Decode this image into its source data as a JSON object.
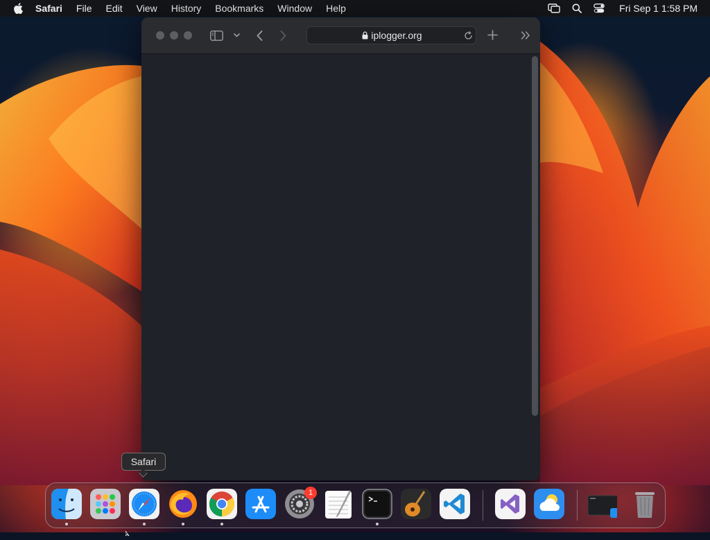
{
  "menubar": {
    "app_name": "Safari",
    "items": [
      "File",
      "Edit",
      "View",
      "History",
      "Bookmarks",
      "Window",
      "Help"
    ],
    "clock": "Fri Sep 1  1:58 PM"
  },
  "browser": {
    "url": "iplogger.org"
  },
  "tooltip": {
    "text": "Safari"
  },
  "dock": {
    "badge_count": "1"
  },
  "colors": {
    "window_bg": "#1f2228",
    "toolbar_bg": "#2b2c30",
    "badge": "#ff3b30"
  }
}
